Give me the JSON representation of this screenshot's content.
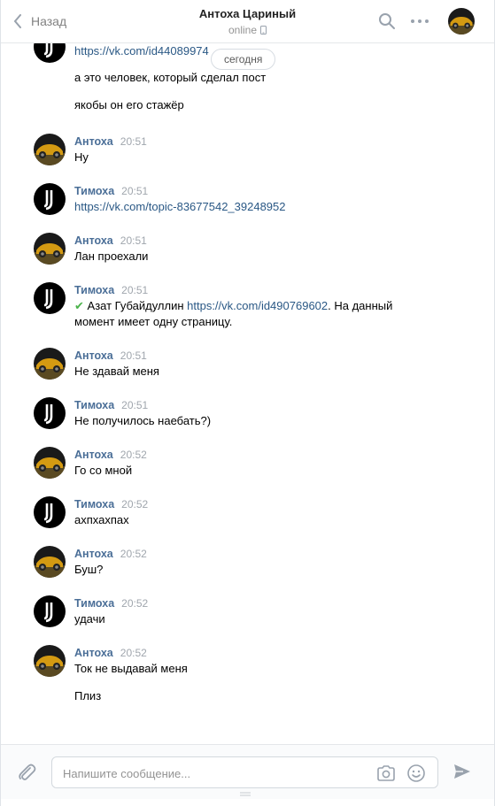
{
  "header": {
    "back_label": "Назад",
    "title": "Антоха Цариный",
    "status": "online"
  },
  "date_pill": "сегодня",
  "messages": [
    {
      "id": "m0",
      "author": "",
      "time": "",
      "lines": [
        {
          "link": "https://vk.com/id44089974",
          "text": ""
        },
        {
          "text": "а это человек, который сделал пост"
        },
        {
          "text": "якобы он его стажёр"
        }
      ]
    },
    {
      "id": "m1",
      "author": "Антоха",
      "time": "20:51",
      "text": "Ну"
    },
    {
      "id": "m2",
      "author": "Тимоха",
      "time": "20:51",
      "link": "https://vk.com/topic-83677542_39248952"
    },
    {
      "id": "m3",
      "author": "Антоха",
      "time": "20:51",
      "text": "Лан проехали"
    },
    {
      "id": "m4",
      "author": "Тимоха",
      "time": "20:51",
      "check": "✔",
      "text_before": " Азат Губайдуллин ",
      "link": "https://vk.com/id490769602",
      "text_after": ". На данный",
      "text_line2": "момент имеет одну страницу."
    },
    {
      "id": "m5",
      "author": "Антоха",
      "time": "20:51",
      "text": "Не здавай меня"
    },
    {
      "id": "m6",
      "author": "Тимоха",
      "time": "20:51",
      "text": "Не получилось наебать?)"
    },
    {
      "id": "m7",
      "author": "Антоха",
      "time": "20:52",
      "text": "Го со мной"
    },
    {
      "id": "m8",
      "author": "Тимоха",
      "time": "20:52",
      "text": "ахпхахпах"
    },
    {
      "id": "m9",
      "author": "Антоха",
      "time": "20:52",
      "text": "Буш?"
    },
    {
      "id": "m10",
      "author": "Тимоха",
      "time": "20:52",
      "text": "удачи"
    },
    {
      "id": "m11",
      "author": "Антоха",
      "time": "20:52",
      "text": "Ток не выдавай меня",
      "text2": "Плиз"
    }
  ],
  "composer": {
    "placeholder": "Напишите сообщение..."
  },
  "colors": {
    "name": "#4a6e97",
    "link": "#2a5885",
    "check": "#4bb34b"
  }
}
